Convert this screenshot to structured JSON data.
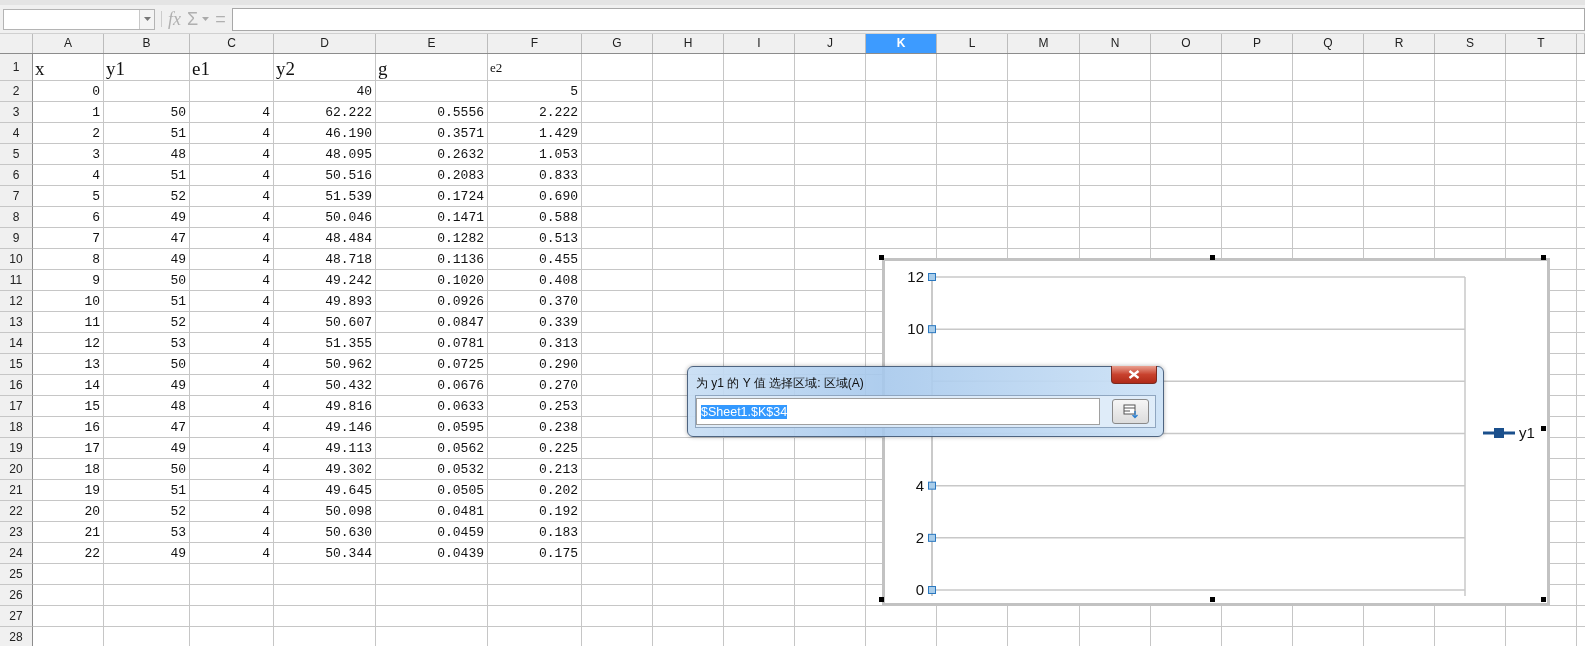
{
  "formula_bar": {
    "function_label": "fx",
    "sum_label": "Σ",
    "equals_label": "=",
    "disabled": true
  },
  "columns": [
    {
      "label": "A",
      "selected": false
    },
    {
      "label": "B",
      "selected": false
    },
    {
      "label": "C",
      "selected": false
    },
    {
      "label": "D",
      "selected": false
    },
    {
      "label": "E",
      "selected": false
    },
    {
      "label": "F",
      "selected": false
    },
    {
      "label": "G",
      "selected": false
    },
    {
      "label": "H",
      "selected": false
    },
    {
      "label": "I",
      "selected": false
    },
    {
      "label": "J",
      "selected": false
    },
    {
      "label": "K",
      "selected": true
    },
    {
      "label": "L",
      "selected": false
    },
    {
      "label": "M",
      "selected": false
    },
    {
      "label": "N",
      "selected": false
    },
    {
      "label": "O",
      "selected": false
    },
    {
      "label": "P",
      "selected": false
    },
    {
      "label": "Q",
      "selected": false
    },
    {
      "label": "R",
      "selected": false
    },
    {
      "label": "S",
      "selected": false
    },
    {
      "label": "T",
      "selected": false
    }
  ],
  "rows": [
    {
      "number": "1",
      "kind": "header",
      "cells": [
        "x",
        "y1",
        "e1",
        "y2",
        "g",
        "e2"
      ]
    },
    {
      "number": "2",
      "kind": "data",
      "cells": [
        "0",
        null,
        null,
        "40",
        null,
        "5"
      ]
    },
    {
      "number": "3",
      "kind": "data",
      "cells": [
        "1",
        "50",
        "4",
        "62.222",
        "0.5556",
        "2.222"
      ]
    },
    {
      "number": "4",
      "kind": "data",
      "cells": [
        "2",
        "51",
        "4",
        "46.190",
        "0.3571",
        "1.429"
      ]
    },
    {
      "number": "5",
      "kind": "data",
      "cells": [
        "3",
        "48",
        "4",
        "48.095",
        "0.2632",
        "1.053"
      ]
    },
    {
      "number": "6",
      "kind": "data",
      "cells": [
        "4",
        "51",
        "4",
        "50.516",
        "0.2083",
        "0.833"
      ]
    },
    {
      "number": "7",
      "kind": "data",
      "cells": [
        "5",
        "52",
        "4",
        "51.539",
        "0.1724",
        "0.690"
      ]
    },
    {
      "number": "8",
      "kind": "data",
      "cells": [
        "6",
        "49",
        "4",
        "50.046",
        "0.1471",
        "0.588"
      ]
    },
    {
      "number": "9",
      "kind": "data",
      "cells": [
        "7",
        "47",
        "4",
        "48.484",
        "0.1282",
        "0.513"
      ]
    },
    {
      "number": "10",
      "kind": "data",
      "cells": [
        "8",
        "49",
        "4",
        "48.718",
        "0.1136",
        "0.455"
      ]
    },
    {
      "number": "11",
      "kind": "data",
      "cells": [
        "9",
        "50",
        "4",
        "49.242",
        "0.1020",
        "0.408"
      ]
    },
    {
      "number": "12",
      "kind": "data",
      "cells": [
        "10",
        "51",
        "4",
        "49.893",
        "0.0926",
        "0.370"
      ]
    },
    {
      "number": "13",
      "kind": "data",
      "cells": [
        "11",
        "52",
        "4",
        "50.607",
        "0.0847",
        "0.339"
      ]
    },
    {
      "number": "14",
      "kind": "data",
      "cells": [
        "12",
        "53",
        "4",
        "51.355",
        "0.0781",
        "0.313"
      ]
    },
    {
      "number": "15",
      "kind": "data",
      "cells": [
        "13",
        "50",
        "4",
        "50.962",
        "0.0725",
        "0.290"
      ]
    },
    {
      "number": "16",
      "kind": "data",
      "cells": [
        "14",
        "49",
        "4",
        "50.432",
        "0.0676",
        "0.270"
      ]
    },
    {
      "number": "17",
      "kind": "data",
      "cells": [
        "15",
        "48",
        "4",
        "49.816",
        "0.0633",
        "0.253"
      ]
    },
    {
      "number": "18",
      "kind": "data",
      "cells": [
        "16",
        "47",
        "4",
        "49.146",
        "0.0595",
        "0.238"
      ]
    },
    {
      "number": "19",
      "kind": "data",
      "cells": [
        "17",
        "49",
        "4",
        "49.113",
        "0.0562",
        "0.225"
      ]
    },
    {
      "number": "20",
      "kind": "data",
      "cells": [
        "18",
        "50",
        "4",
        "49.302",
        "0.0532",
        "0.213"
      ]
    },
    {
      "number": "21",
      "kind": "data",
      "cells": [
        "19",
        "51",
        "4",
        "49.645",
        "0.0505",
        "0.202"
      ]
    },
    {
      "number": "22",
      "kind": "data",
      "cells": [
        "20",
        "52",
        "4",
        "50.098",
        "0.0481",
        "0.192"
      ]
    },
    {
      "number": "23",
      "kind": "data",
      "cells": [
        "21",
        "53",
        "4",
        "50.630",
        "0.0459",
        "0.183"
      ]
    },
    {
      "number": "24",
      "kind": "data",
      "cells": [
        "22",
        "49",
        "4",
        "50.344",
        "0.0439",
        "0.175"
      ]
    },
    {
      "number": "25",
      "kind": "empty"
    },
    {
      "number": "26",
      "kind": "empty"
    },
    {
      "number": "27",
      "kind": "empty"
    },
    {
      "number": "28",
      "kind": "empty"
    }
  ],
  "chart": {
    "selected": true,
    "chart_data": {
      "type": "line",
      "grid": true,
      "ylim": [
        0,
        12
      ],
      "yticks": [
        0,
        2,
        4,
        10,
        12
      ],
      "series": [
        {
          "name": "y1",
          "color": "#1a4f8c"
        }
      ]
    }
  },
  "dialog": {
    "title": "为 y1 的 Y 值 选择区域: 区域(A)",
    "range_value": "$Sheet1.$K$34",
    "value_selected": true
  }
}
